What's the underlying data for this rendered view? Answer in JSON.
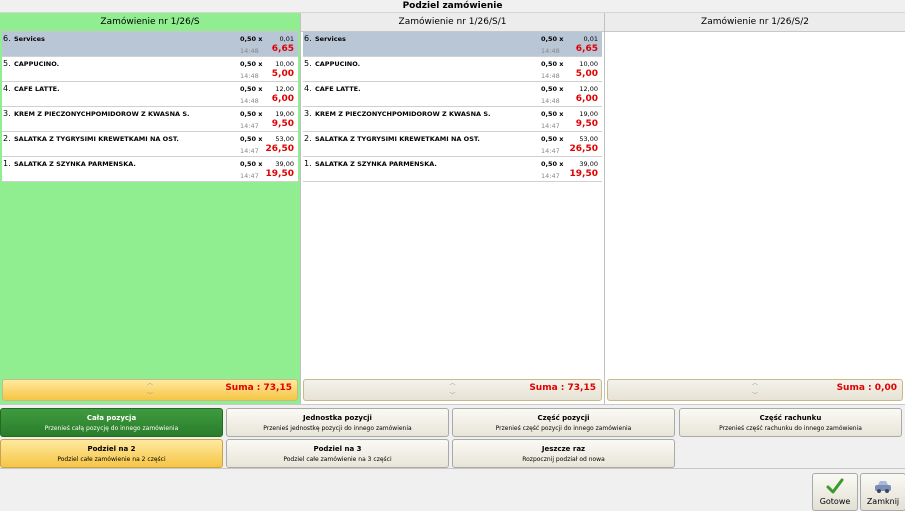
{
  "window": {
    "title": "Podziel zamówienie"
  },
  "columns": [
    {
      "header": "Zamówienie nr 1/26/S",
      "sum": "Suma : 73,15",
      "items": [
        {
          "no": "6.",
          "name": "Services",
          "qty": "0,50 x",
          "price": "0,01",
          "time": "14:48",
          "total": "6,65",
          "selected": true
        },
        {
          "no": "5.",
          "name": "CAPPUCINO.",
          "qty": "0,50 x",
          "price": "10,00",
          "time": "14:48",
          "total": "5,00"
        },
        {
          "no": "4.",
          "name": "CAFE LATTE.",
          "qty": "0,50 x",
          "price": "12,00",
          "time": "14:48",
          "total": "6,00"
        },
        {
          "no": "3.",
          "name": "KREM Z PIECZONYCHPOMIDOROW Z KWASNA S.",
          "qty": "0,50 x",
          "price": "19,00",
          "time": "14:47",
          "total": "9,50"
        },
        {
          "no": "2.",
          "name": "SALATKA Z TYGRYSIMI KREWETKAMI NA OST.",
          "qty": "0,50 x",
          "price": "53,00",
          "time": "14:47",
          "total": "26,50"
        },
        {
          "no": "1.",
          "name": "SALATKA Z SZYNKA PARMENSKA.",
          "qty": "0,50 x",
          "price": "39,00",
          "time": "14:47",
          "total": "19,50"
        }
      ]
    },
    {
      "header": "Zamówienie nr 1/26/S/1",
      "sum": "Suma : 73,15",
      "items": [
        {
          "no": "6.",
          "name": "Services",
          "qty": "0,50 x",
          "price": "0,01",
          "time": "14:48",
          "total": "6,65",
          "selected": true
        },
        {
          "no": "5.",
          "name": "CAPPUCINO.",
          "qty": "0,50 x",
          "price": "10,00",
          "time": "14:48",
          "total": "5,00"
        },
        {
          "no": "4.",
          "name": "CAFE LATTE.",
          "qty": "0,50 x",
          "price": "12,00",
          "time": "14:48",
          "total": "6,00"
        },
        {
          "no": "3.",
          "name": "KREM Z PIECZONYCHPOMIDOROW Z KWASNA S.",
          "qty": "0,50 x",
          "price": "19,00",
          "time": "14:47",
          "total": "9,50"
        },
        {
          "no": "2.",
          "name": "SALATKA Z TYGRYSIMI KREWETKAMI NA OST.",
          "qty": "0,50 x",
          "price": "53,00",
          "time": "14:47",
          "total": "26,50"
        },
        {
          "no": "1.",
          "name": "SALATKA Z SZYNKA PARMENSKA.",
          "qty": "0,50 x",
          "price": "39,00",
          "time": "14:47",
          "total": "19,50"
        }
      ]
    },
    {
      "header": "Zamówienie nr 1/26/S/2",
      "sum": "Suma : 0,00",
      "items": []
    }
  ],
  "actions": {
    "cala_pozycja": {
      "title": "Cała pozycja",
      "sub": "Przenieś całą pozycję do innego zamówienia"
    },
    "jednostka_pozycji": {
      "title": "Jednostka pozycji",
      "sub": "Przenieś jednostkę pozycji do innego zamówienia"
    },
    "czesc_pozycji": {
      "title": "Część pozycji",
      "sub": "Przenieś część pozycji do innego zamówienia"
    },
    "czesc_rachunku": {
      "title": "Część rachunku",
      "sub": "Przenieś część rachunku do innego zamówienia"
    },
    "podziel_na_2": {
      "title": "Podziel na 2",
      "sub": "Podziel całe zamówienie na 2 części"
    },
    "podziel_na_3": {
      "title": "Podziel na 3",
      "sub": "Podziel całe zamówienie na 3 części"
    },
    "jeszcze_raz": {
      "title": "Jeszcze raz",
      "sub": "Rozpocznij podział od nowa"
    }
  },
  "footer": {
    "gotowe": {
      "label": "Gotowe",
      "icon": "checkmark-icon"
    },
    "zamknij": {
      "label": "Zamknij",
      "icon": "close-car-icon"
    }
  },
  "colors": {
    "accent_green": "#90ee90",
    "selected_action": "#2a7d2a",
    "highlight_yellow": "#f6c544",
    "amount_red": "#e00000",
    "selected_row": "#b8c6d6"
  }
}
